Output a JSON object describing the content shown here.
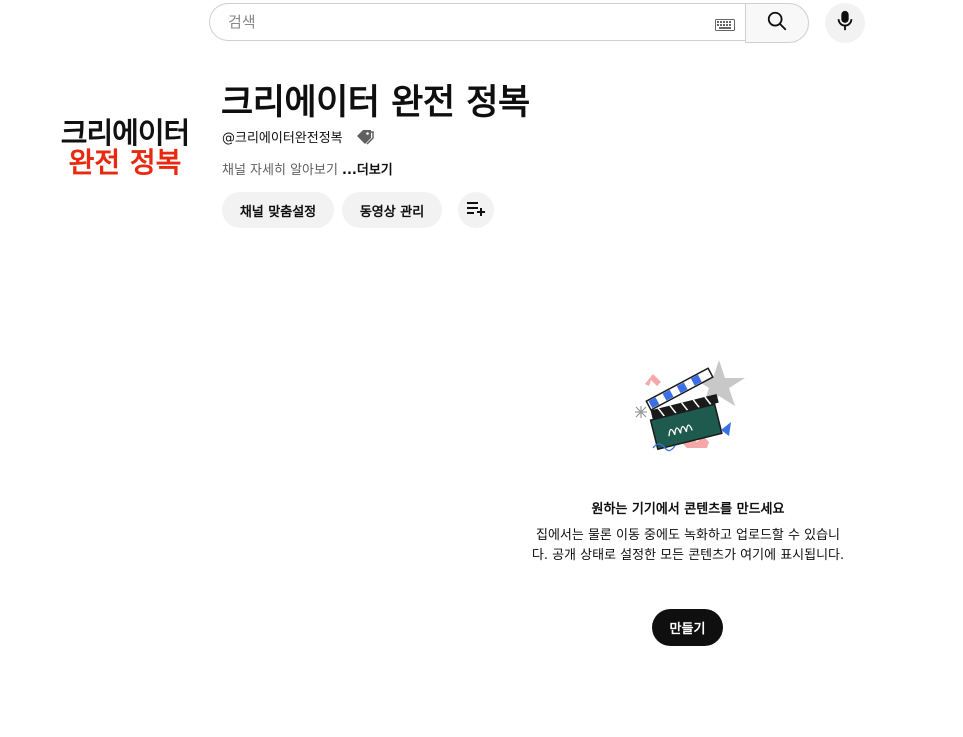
{
  "search": {
    "placeholder": "검색"
  },
  "channel": {
    "avatar_line1": "크리에이터",
    "avatar_line2": "완전 정복",
    "title": "크리에이터 완전 정복",
    "handle": "@크리에이터완전정복",
    "description": "채널 자세히 알아보기 ",
    "more_label": "...더보기",
    "customize_label": "채널 맞춤설정",
    "manage_label": "동영상 관리"
  },
  "empty_state": {
    "title": "원하는 기기에서 콘텐츠를 만드세요",
    "description": "집에서는 물론 이동 중에도 녹화하고 업로드할 수 있습니다. 공개 상태로 설정한 모든 콘텐츠가 여기에 표시됩니다.",
    "create_label": "만들기"
  },
  "colors": {
    "avatar_accent": "#e8290f",
    "primary_dark": "#0f0f0f",
    "pill_bg": "#f2f2f2"
  }
}
